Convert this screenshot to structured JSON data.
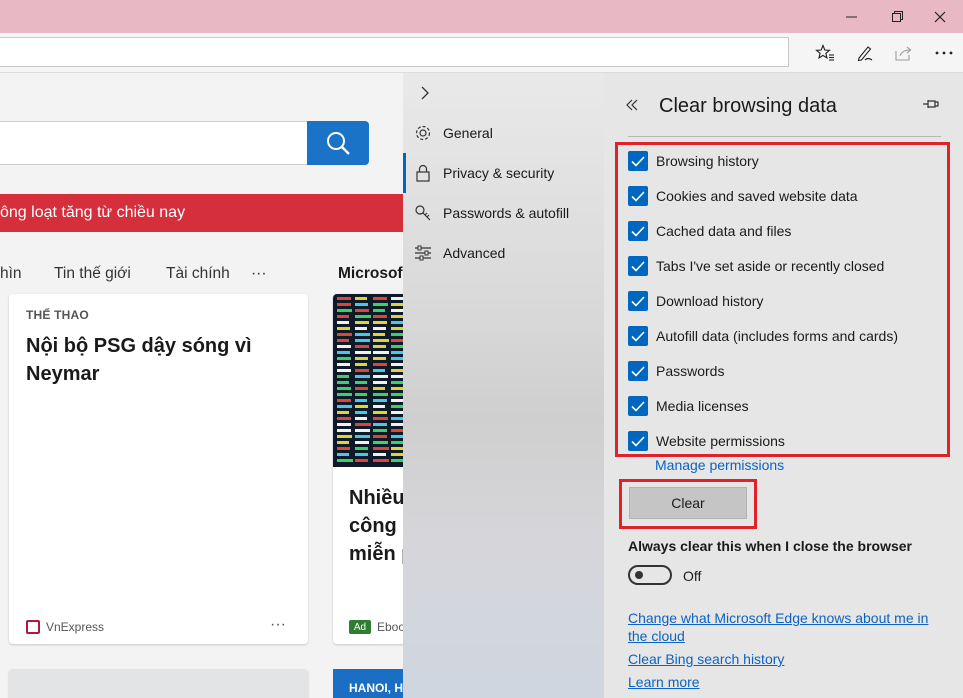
{
  "window": {
    "controls": [
      "minimize",
      "restore",
      "close"
    ]
  },
  "toolbar": {
    "icons": [
      "favorites-star-icon",
      "pen-icon",
      "share-icon",
      "more-icon"
    ]
  },
  "page": {
    "banner_text": "ông loạt tăng từ chiều nay",
    "nav_tabs": [
      "hìn",
      "Tin thế giới",
      "Tài chính",
      "···",
      "Microsof"
    ],
    "card1": {
      "category": "THỂ THAO",
      "headline": "Nội bộ PSG dậy sóng vì Neymar",
      "source": "VnExpress",
      "more": "···"
    },
    "card2": {
      "headline_lines": [
        "Nhiều",
        "công n",
        "miễn p"
      ],
      "ad_label": "Ad",
      "source": "Eboo"
    },
    "card3": {
      "label": "HANOI, H"
    }
  },
  "settings_nav": {
    "items": [
      {
        "label": "General",
        "icon": "gear-icon"
      },
      {
        "label": "Privacy & security",
        "icon": "lock-icon",
        "active": true
      },
      {
        "label": "Passwords & autofill",
        "icon": "key-icon"
      },
      {
        "label": "Advanced",
        "icon": "sliders-icon"
      }
    ]
  },
  "panel": {
    "title": "Clear browsing data",
    "checkboxes": [
      {
        "label": "Browsing history",
        "checked": true
      },
      {
        "label": "Cookies and saved website data",
        "checked": true
      },
      {
        "label": "Cached data and files",
        "checked": true
      },
      {
        "label": "Tabs I've set aside or recently closed",
        "checked": true
      },
      {
        "label": "Download history",
        "checked": true
      },
      {
        "label": "Autofill data (includes forms and cards)",
        "checked": true
      },
      {
        "label": "Passwords",
        "checked": true
      },
      {
        "label": "Media licenses",
        "checked": true
      },
      {
        "label": "Website permissions",
        "checked": true
      }
    ],
    "manage_permissions": "Manage permissions",
    "clear_button": "Clear",
    "always_clear_label": "Always clear this when I close the browser",
    "toggle_state": "Off",
    "links": [
      "Change what Microsoft Edge knows about me in the cloud",
      "Clear Bing search history",
      "Learn more"
    ]
  },
  "colors": {
    "titlebar": "#e8b9c5",
    "accent": "#0067c0",
    "highlight": "#e0232b",
    "banner": "#d62f3c"
  }
}
